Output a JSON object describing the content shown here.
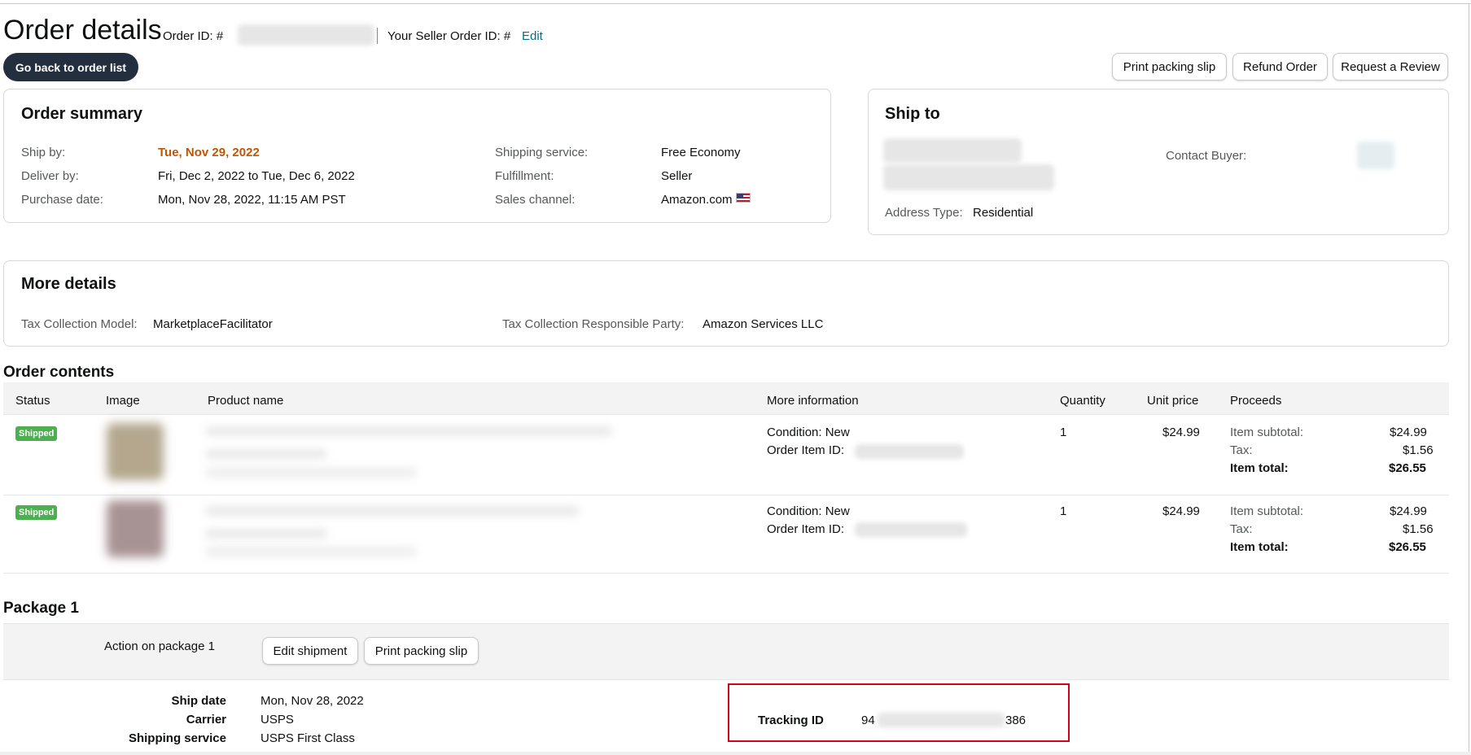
{
  "header": {
    "title": "Order details",
    "order_id_label": "Order ID: # ",
    "seller_order_id_label": "Your Seller Order ID: #",
    "edit_link": "Edit"
  },
  "actions": {
    "back": "Go back to order list",
    "print_packing_slip": "Print packing slip",
    "refund": "Refund Order",
    "review": "Request a Review"
  },
  "order_summary": {
    "title": "Order summary",
    "ship_by_label": "Ship by:",
    "ship_by_value": "Tue, Nov 29, 2022",
    "deliver_by_label": "Deliver by:",
    "deliver_by_value": "Fri, Dec 2, 2022 to Tue, Dec 6, 2022",
    "purchase_date_label": "Purchase date:",
    "purchase_date_value": "Mon, Nov 28, 2022, 11:15 AM PST",
    "shipping_service_label": "Shipping service:",
    "shipping_service_value": "Free Economy",
    "fulfillment_label": "Fulfillment:",
    "fulfillment_value": "Seller",
    "sales_channel_label": "Sales channel:",
    "sales_channel_value": "Amazon.com",
    "sales_channel_flag_icon": "us-flag-icon"
  },
  "ship_to": {
    "title": "Ship to",
    "contact_buyer_label": "Contact Buyer:",
    "address_type_label": "Address Type:",
    "address_type_value": "Residential"
  },
  "more_details": {
    "title": "More details",
    "tax_model_label": "Tax Collection Model:",
    "tax_model_value": "MarketplaceFacilitator",
    "tax_party_label": "Tax Collection Responsible Party:",
    "tax_party_value": "Amazon Services LLC"
  },
  "order_contents": {
    "title": "Order contents",
    "columns": [
      "Status",
      "Image",
      "Product name",
      "More information",
      "Quantity",
      "Unit price",
      "Proceeds"
    ],
    "rows": [
      {
        "status": "Shipped",
        "condition": "Condition: New",
        "order_item_label": "Order Item ID:",
        "quantity": "1",
        "unit_price": "$24.99",
        "subtotal_label": "Item subtotal:",
        "subtotal": "$24.99",
        "tax_label": "Tax:",
        "tax": "$1.56",
        "total_label": "Item total:",
        "total": "$26.55"
      },
      {
        "status": "Shipped",
        "condition": "Condition: New",
        "order_item_label": "Order Item ID:",
        "quantity": "1",
        "unit_price": "$24.99",
        "subtotal_label": "Item subtotal:",
        "subtotal": "$24.99",
        "tax_label": "Tax:",
        "tax": "$1.56",
        "total_label": "Item total:",
        "total": "$26.55"
      }
    ]
  },
  "package": {
    "title": "Package 1",
    "action_label": "Action on package 1",
    "edit_shipment": "Edit shipment",
    "print_packing_slip": "Print packing slip",
    "ship_date_label": "Ship date",
    "ship_date_value": "Mon, Nov 28, 2022",
    "carrier_label": "Carrier",
    "carrier_value": "USPS",
    "shipping_service_label": "Shipping service",
    "shipping_service_value": "USPS First Class",
    "tracking_label": "Tracking ID",
    "tracking_prefix": "94",
    "tracking_suffix": "386"
  },
  "colors": {
    "accent_link": "#007185",
    "ship_by_highlight": "#c45500",
    "shipped_badge": "#4caf50",
    "dark_button": "#232f3e",
    "tracking_highlight_border": "#d0021b"
  }
}
